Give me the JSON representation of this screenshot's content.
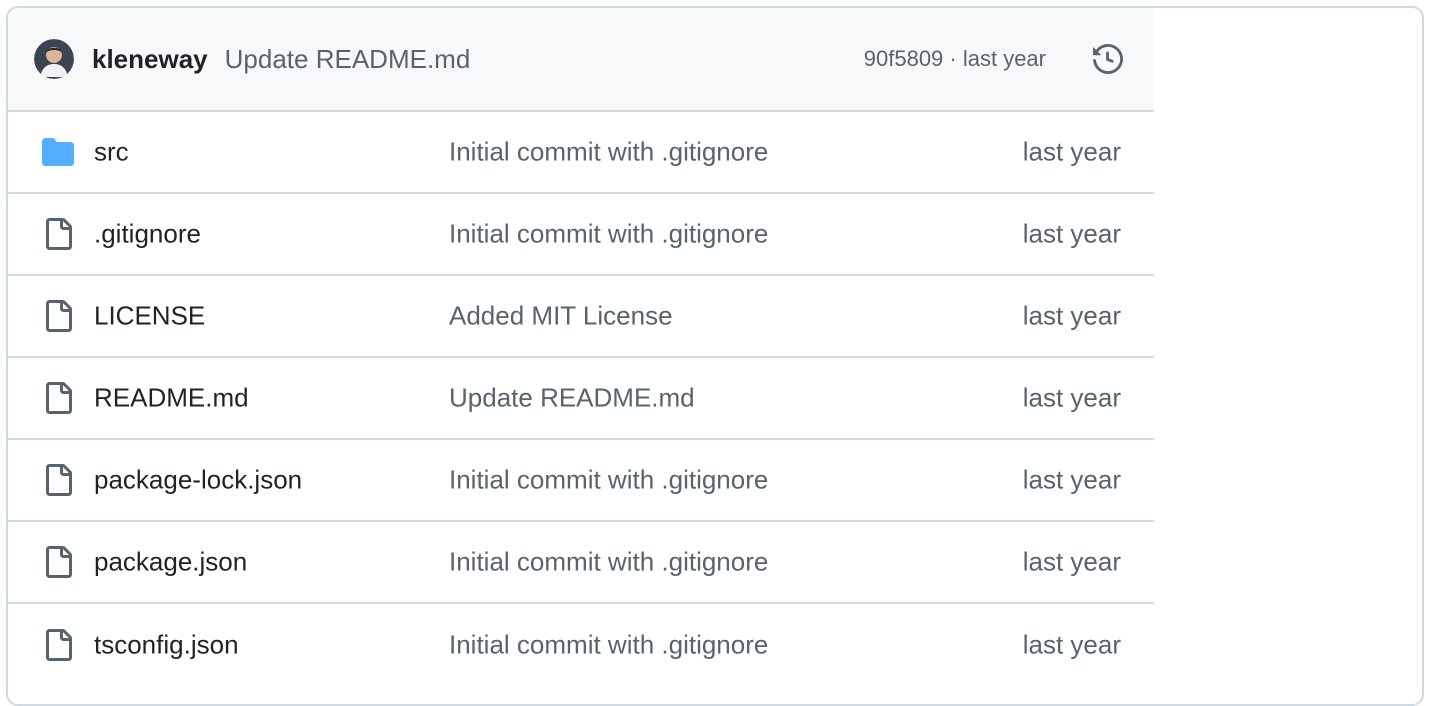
{
  "latest_commit": {
    "author": "kleneway",
    "message": "Update README.md",
    "hash_and_time": "90f5809 · last year"
  },
  "files": [
    {
      "name": "src",
      "type": "folder",
      "message": "Initial commit with .gitignore",
      "time": "last year"
    },
    {
      "name": ".gitignore",
      "type": "file",
      "message": "Initial commit with .gitignore",
      "time": "last year"
    },
    {
      "name": "LICENSE",
      "type": "file",
      "message": "Added MIT License",
      "time": "last year"
    },
    {
      "name": "README.md",
      "type": "file",
      "message": "Update README.md",
      "time": "last year"
    },
    {
      "name": "package-lock.json",
      "type": "file",
      "message": "Initial commit with .gitignore",
      "time": "last year"
    },
    {
      "name": "package.json",
      "type": "file",
      "message": "Initial commit with .gitignore",
      "time": "last year"
    },
    {
      "name": "tsconfig.json",
      "type": "file",
      "message": "Initial commit with .gitignore",
      "time": "last year"
    }
  ],
  "colors": {
    "folder": "#54aeff",
    "border": "#d1d9e0",
    "header_bg": "#f6f8fa",
    "muted_text": "#59636e"
  }
}
